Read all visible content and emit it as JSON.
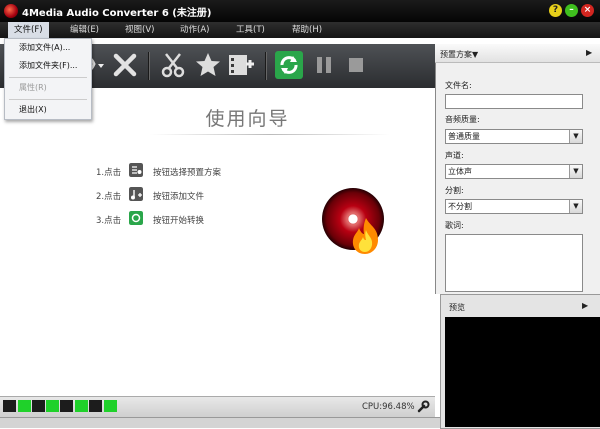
{
  "window": {
    "title": "4Media Audio Converter 6 (未注册)"
  },
  "menubar": {
    "items": [
      {
        "id": "file",
        "label": "文件(F)"
      },
      {
        "id": "edit",
        "label": "编辑(E)"
      },
      {
        "id": "view",
        "label": "视图(V)"
      },
      {
        "id": "action",
        "label": "动作(A)"
      },
      {
        "id": "tools",
        "label": "工具(T)"
      },
      {
        "id": "help",
        "label": "帮助(H)"
      }
    ]
  },
  "file_menu": {
    "items": [
      {
        "label": "添加文件(A)...",
        "enabled": true
      },
      {
        "label": "添加文件夹(F)...",
        "enabled": true
      },
      {
        "label": "属性(R)",
        "enabled": false
      },
      {
        "label": "退出(X)",
        "enabled": true
      }
    ]
  },
  "wizard": {
    "title": "使用向导",
    "steps": [
      {
        "num": "1.点击",
        "text": "按钮选择预置方案",
        "icon": "profile-icon"
      },
      {
        "num": "2.点击",
        "text": "按钮添加文件",
        "icon": "add-file-icon"
      },
      {
        "num": "3.点击",
        "text": "按钮开始转换",
        "icon": "convert-icon"
      }
    ]
  },
  "status": {
    "cpu": "CPU:96.48%"
  },
  "panel": {
    "header": "预置方案",
    "filename_label": "文件名:",
    "filename_value": "",
    "quality_label": "音频质量:",
    "quality_value": "普通质量",
    "channel_label": "声道:",
    "channel_value": "立体声",
    "split_label": "分割:",
    "split_value": "不分割",
    "lyrics_label": "歌词:",
    "preview_label": "预览"
  },
  "colors": {
    "accent_green": "#1fd12a",
    "titlebar": "#111111",
    "toolbar": "#3c3f43"
  }
}
